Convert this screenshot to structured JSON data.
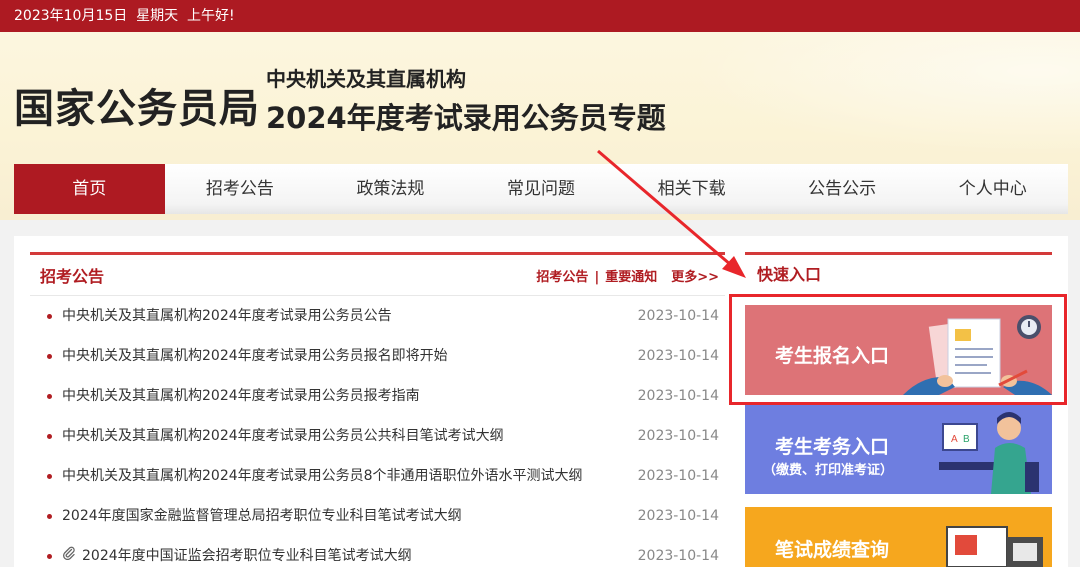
{
  "topbar": {
    "text": "2023年10月15日  星期天  上午好!"
  },
  "banner": {
    "site_title": "国家公务员局",
    "subtitle_line1": "中央机关及其直属机构",
    "subtitle_line2": "2024年度考试录用公务员专题"
  },
  "nav": {
    "items": [
      {
        "label": "首页"
      },
      {
        "label": "招考公告"
      },
      {
        "label": "政策法规"
      },
      {
        "label": "常见问题"
      },
      {
        "label": "相关下载"
      },
      {
        "label": "公告公示"
      },
      {
        "label": "个人中心"
      }
    ],
    "active_index": 0
  },
  "announcements": {
    "title": "招考公告",
    "link1": "招考公告",
    "separator": "|",
    "link2": "重要通知",
    "more": "更多>>",
    "items": [
      {
        "title": "中央机关及其直属机构2024年度考试录用公务员公告",
        "date": "2023-10-14"
      },
      {
        "title": "中央机关及其直属机构2024年度考试录用公务员报名即将开始",
        "date": "2023-10-14"
      },
      {
        "title": "中央机关及其直属机构2024年度考试录用公务员报考指南",
        "date": "2023-10-14"
      },
      {
        "title": "中央机关及其直属机构2024年度考试录用公务员公共科目笔试考试大纲",
        "date": "2023-10-14"
      },
      {
        "title": "中央机关及其直属机构2024年度考试录用公务员8个非通用语职位外语水平测试大纲",
        "date": "2023-10-14"
      },
      {
        "title": "2024年度国家金融监督管理总局招考职位专业科目笔试考试大纲",
        "date": "2023-10-14"
      },
      {
        "title": "2024年度中国证监会招考职位专业科目笔试考试大纲",
        "date": "2023-10-14",
        "attachment_icon": "paperclip-icon"
      }
    ]
  },
  "quick_entry": {
    "title": "快速入口",
    "registration": {
      "label": "考生报名入口"
    },
    "services": {
      "label": "考生考务入口",
      "sub_label": "（缴费、打印准考证）"
    },
    "scores": {
      "label": "笔试成绩查询"
    }
  },
  "colors": {
    "brand_red": "#ad1a22",
    "highlight_red": "#e8262b",
    "registration_bg": "#dd7377",
    "services_bg": "#6e7ee0",
    "scores_bg": "#f6a71e"
  }
}
